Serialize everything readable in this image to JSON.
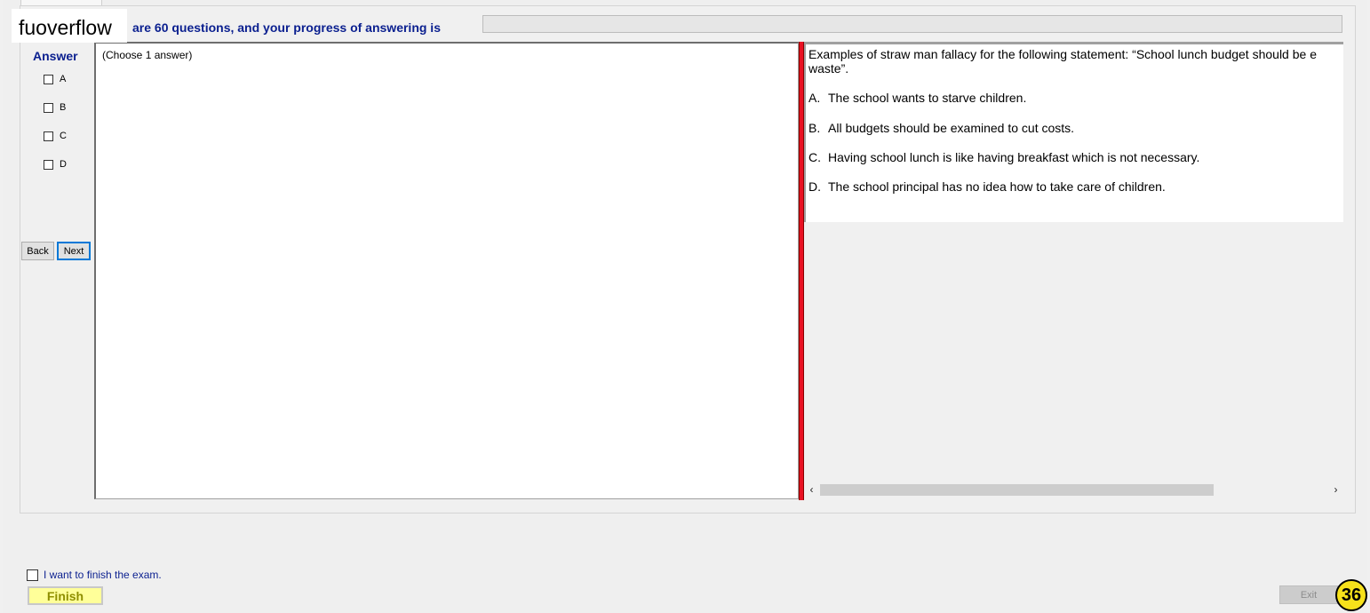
{
  "watermark": "fuoverflow",
  "header": {
    "progress_text": "are 60 questions, and your progress of answering is",
    "progress_fraction": 0
  },
  "answer_panel": {
    "title": "Answer",
    "options": [
      {
        "label": "A",
        "checked": false
      },
      {
        "label": "B",
        "checked": false
      },
      {
        "label": "C",
        "checked": false
      },
      {
        "label": "D",
        "checked": false
      }
    ],
    "back_label": "Back",
    "next_label": "Next"
  },
  "answer_area": {
    "instruction": "(Choose 1 answer)"
  },
  "question": {
    "stem_line1": "Examples of straw man fallacy for the following statement: “School lunch budget should be e",
    "stem_line2": "waste”.",
    "choices": [
      {
        "letter": "A.",
        "text": "The school wants to starve children."
      },
      {
        "letter": "B.",
        "text": "All budgets should be examined to cut costs."
      },
      {
        "letter": "C.",
        "text": "Having school lunch is like having breakfast which is not necessary."
      },
      {
        "letter": "D.",
        "text": "The school principal has no idea how to take care of children."
      }
    ],
    "scroll_left_icon": "‹",
    "scroll_right_icon": "›"
  },
  "footer": {
    "finish_confirm_label": "I want to finish the exam.",
    "finish_label": "Finish",
    "exit_label": "Exit",
    "page_badge": "36"
  },
  "colors": {
    "label_blue": "#0a1f8f",
    "splitter_red": "#e81123",
    "finish_bg": "#ffff99",
    "badge_yellow": "#f7e21b"
  }
}
